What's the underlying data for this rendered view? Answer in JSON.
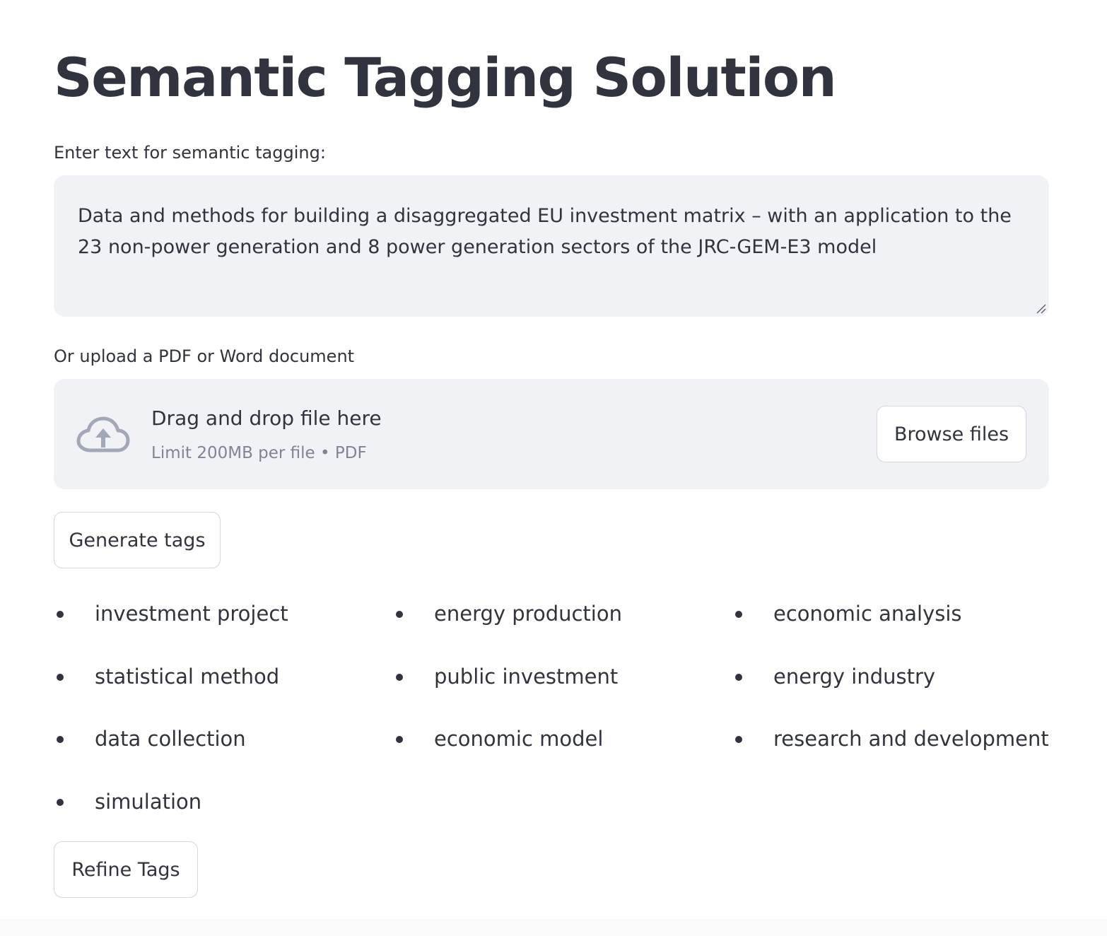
{
  "title": "Semantic Tagging Solution",
  "text_input": {
    "label": "Enter text for semantic tagging:",
    "value": "Data and methods for building a disaggregated EU investment matrix – with an application to the 23 non-power generation and 8 power generation sectors of the JRC-GEM-E3 model"
  },
  "uploader": {
    "label": "Or upload a PDF or Word document",
    "drop_text": "Drag and drop file here",
    "limit_text": "Limit 200MB per file • PDF",
    "browse_label": "Browse files",
    "icon": "cloud-upload-icon"
  },
  "generate_label": "Generate tags",
  "tags": [
    "investment project",
    "energy production",
    "economic analysis",
    "statistical method",
    "public investment",
    "energy industry",
    "data collection",
    "economic model",
    "research and development",
    "simulation"
  ],
  "refine_label": "Refine Tags",
  "colors": {
    "text": "#31333f",
    "input_bg": "#f0f2f6",
    "muted": "#808495",
    "icon": "#a3a8b8",
    "border": "#d5d7de"
  }
}
